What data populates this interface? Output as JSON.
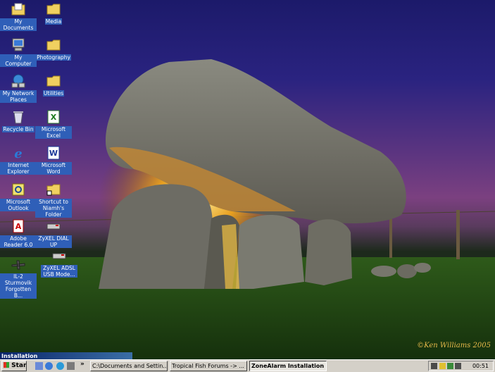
{
  "desktop_icons": [
    {
      "label": "My Documents",
      "icon": "my-documents-icon"
    },
    {
      "label": "Media",
      "icon": "folder-icon"
    },
    {
      "label": "My Computer",
      "icon": "my-computer-icon"
    },
    {
      "label": "Photography",
      "icon": "folder-icon"
    },
    {
      "label": "My Network Places",
      "icon": "network-icon"
    },
    {
      "label": "Utilities",
      "icon": "folder-icon"
    },
    {
      "label": "Recycle Bin",
      "icon": "recycle-bin-icon"
    },
    {
      "label": "Microsoft Excel",
      "icon": "excel-icon"
    },
    {
      "label": "Internet Explorer",
      "icon": "internet-explorer-icon"
    },
    {
      "label": "Microsoft Word",
      "icon": "word-icon"
    },
    {
      "label": "Microsoft Outlook",
      "icon": "outlook-icon"
    },
    {
      "label": "Shortcut to Niamh's Folder",
      "icon": "folder-shortcut-icon"
    },
    {
      "label": "Adobe Reader 6.0",
      "icon": "adobe-reader-icon"
    },
    {
      "label": "ZyXEL DIAL UP",
      "icon": "modem-icon"
    },
    {
      "label": "IL-2 Sturmovik Forgotten B...",
      "icon": "game-icon"
    },
    {
      "label": "ZyXEL ADSL USB Mode...",
      "icon": "modem-icon"
    }
  ],
  "wallpaper_credit": "©Ken Williams 2005",
  "install_window_title": "Installation",
  "taskbar": {
    "start_label": "Start",
    "overflow_glyph": "»",
    "tasks": [
      {
        "label": "C:\\Documents and Settin..."
      },
      {
        "label": "Tropical Fish Forums -> ..."
      },
      {
        "label": "ZoneAlarm Installation"
      }
    ],
    "clock": "00:51"
  },
  "colors": {
    "label_bg": "#2f5fb8",
    "taskbar": "#d4d0c8",
    "credit": "#e6b84a"
  }
}
